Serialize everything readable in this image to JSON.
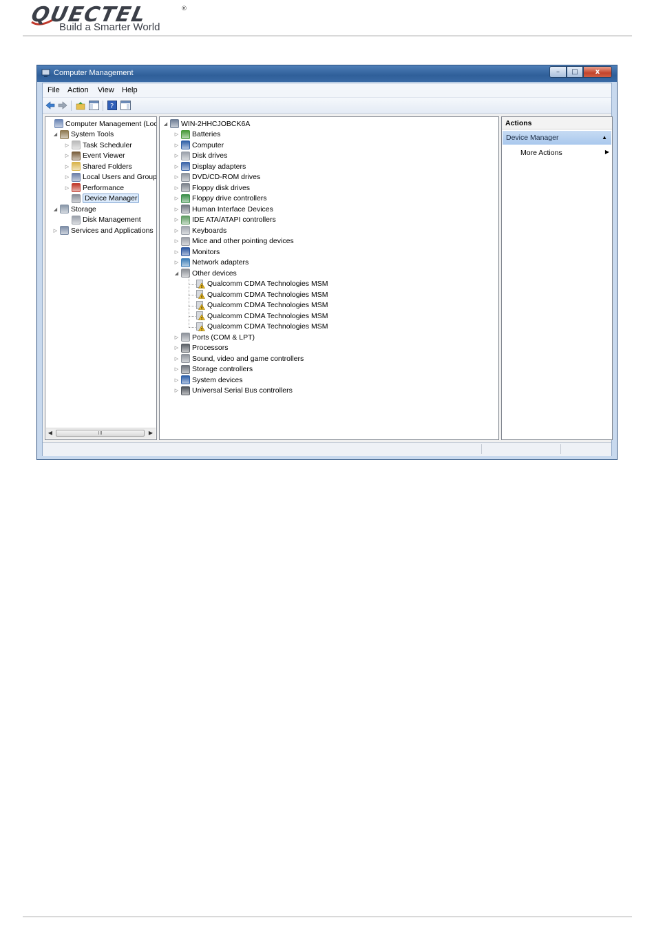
{
  "doc": {
    "logo_text": "QUECTEL",
    "logo_reg": "®",
    "tagline": "Build a Smarter World"
  },
  "window": {
    "title": "Computer Management",
    "buttons": {
      "minimize": "–",
      "maximize": "□",
      "close": "x"
    }
  },
  "menu": [
    "File",
    "Action",
    "View",
    "Help"
  ],
  "left_tree": [
    {
      "label": "Computer Management (Local",
      "level": 0,
      "expander": "",
      "icon": "computer-management-icon",
      "color": "#6b86b5"
    },
    {
      "label": "System Tools",
      "level": 1,
      "expander": "◢",
      "icon": "system-tools-icon",
      "color": "#8f7a52"
    },
    {
      "label": "Task Scheduler",
      "level": 2,
      "expander": "▷",
      "icon": "clock-icon",
      "color": "#b9b9b9"
    },
    {
      "label": "Event Viewer",
      "level": 2,
      "expander": "▷",
      "icon": "event-viewer-icon",
      "color": "#7a5e3c"
    },
    {
      "label": "Shared Folders",
      "level": 2,
      "expander": "▷",
      "icon": "shared-folder-icon",
      "color": "#d9b44a"
    },
    {
      "label": "Local Users and Groups",
      "level": 2,
      "expander": "▷",
      "icon": "users-icon",
      "color": "#6b7fa8"
    },
    {
      "label": "Performance",
      "level": 2,
      "expander": "▷",
      "icon": "performance-icon",
      "color": "#c0392b"
    },
    {
      "label": "Device Manager",
      "level": 2,
      "expander": "",
      "icon": "device-manager-icon",
      "color": "#8a8f99",
      "selected": true
    },
    {
      "label": "Storage",
      "level": 1,
      "expander": "◢",
      "icon": "storage-icon",
      "color": "#8896a8"
    },
    {
      "label": "Disk Management",
      "level": 2,
      "expander": "",
      "icon": "disk-management-icon",
      "color": "#9aa0aa"
    },
    {
      "label": "Services and Applications",
      "level": 1,
      "expander": "▷",
      "icon": "services-icon",
      "color": "#7d8da6"
    }
  ],
  "left_scroll": {
    "thumb_grip": "III",
    "left": "◀",
    "right": "▶"
  },
  "device_tree": {
    "root": "WIN-2HHCJOBCK6A",
    "categories": [
      {
        "label": "Batteries",
        "icon": "battery-icon",
        "color": "#4a9a3a"
      },
      {
        "label": "Computer",
        "icon": "computer-icon",
        "color": "#2f5fa7"
      },
      {
        "label": "Disk drives",
        "icon": "disk-drive-icon",
        "color": "#9aa0aa"
      },
      {
        "label": "Display adapters",
        "icon": "display-adapter-icon",
        "color": "#3a64a8"
      },
      {
        "label": "DVD/CD-ROM drives",
        "icon": "dvd-icon",
        "color": "#8d939c"
      },
      {
        "label": "Floppy disk drives",
        "icon": "floppy-disk-icon",
        "color": "#7d838c"
      },
      {
        "label": "Floppy drive controllers",
        "icon": "floppy-controller-icon",
        "color": "#3b8f4a"
      },
      {
        "label": "Human Interface Devices",
        "icon": "hid-icon",
        "color": "#707680"
      },
      {
        "label": "IDE ATA/ATAPI controllers",
        "icon": "ide-icon",
        "color": "#5f9a62"
      },
      {
        "label": "Keyboards",
        "icon": "keyboard-icon",
        "color": "#a0a5ad"
      },
      {
        "label": "Mice and other pointing devices",
        "icon": "mouse-icon",
        "color": "#9a9ea6"
      },
      {
        "label": "Monitors",
        "icon": "monitor-icon",
        "color": "#2c57a0"
      },
      {
        "label": "Network adapters",
        "icon": "network-adapter-icon",
        "color": "#3f7fb8"
      },
      {
        "label": "Other devices",
        "icon": "other-devices-icon",
        "color": "#8c9096",
        "expanded": true,
        "children": [
          "Qualcomm CDMA Technologies MSM",
          "Qualcomm CDMA Technologies MSM",
          "Qualcomm CDMA Technologies MSM",
          "Qualcomm CDMA Technologies MSM",
          "Qualcomm CDMA Technologies MSM"
        ]
      },
      {
        "label": "Ports (COM & LPT)",
        "icon": "ports-icon",
        "color": "#8e939b"
      },
      {
        "label": "Processors",
        "icon": "processor-icon",
        "color": "#5a5f66"
      },
      {
        "label": "Sound, video and game controllers",
        "icon": "sound-icon",
        "color": "#8e939b"
      },
      {
        "label": "Storage controllers",
        "icon": "storage-controller-icon",
        "color": "#6d737c"
      },
      {
        "label": "System devices",
        "icon": "system-devices-icon",
        "color": "#2f5fa7"
      },
      {
        "label": "Universal Serial Bus controllers",
        "icon": "usb-icon",
        "color": "#4e535a"
      }
    ],
    "warning_color": "#e8b923"
  },
  "actions": {
    "header": "Actions",
    "section": "Device Manager",
    "section_arrow": "▲",
    "more": "More Actions",
    "more_arrow": "▶"
  },
  "colors": {
    "title_bar": "#3a6aa5",
    "selection": "#dcebfc",
    "actions_highlight": "#bcd5f2"
  }
}
